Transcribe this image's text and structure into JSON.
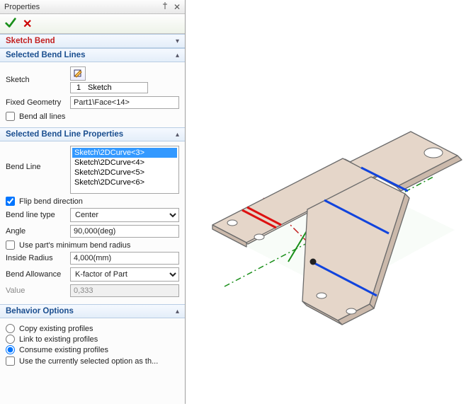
{
  "panel": {
    "title": "Properties",
    "feature_name": "Sketch Bend"
  },
  "sections": {
    "selected_bend_lines": {
      "title": "Selected Bend Lines",
      "sketch_label": "Sketch",
      "sketch_index": "1",
      "sketch_name": "Sketch",
      "fixed_geometry_label": "Fixed Geometry",
      "fixed_geometry_value": "Part1\\Face<14>",
      "bend_all_label": "Bend all lines"
    },
    "bend_props": {
      "title": "Selected Bend Line Properties",
      "bend_line_label": "Bend Line",
      "items": [
        "Sketch\\2DCurve<3>",
        "Sketch\\2DCurve<4>",
        "Sketch\\2DCurve<5>",
        "Sketch\\2DCurve<6>"
      ],
      "flip_label": "Flip bend direction",
      "line_type_label": "Bend line type",
      "line_type_value": "Center",
      "angle_label": "Angle",
      "angle_value": "90,000(deg)",
      "use_min_radius_label": "Use part's minimum bend radius",
      "inside_radius_label": "Inside Radius",
      "inside_radius_value": "4,000(mm)",
      "bend_allowance_label": "Bend Allowance",
      "bend_allowance_value": "K-factor of Part",
      "value_label": "Value",
      "value_value": "0,333"
    },
    "behavior": {
      "title": "Behavior Options",
      "copy_label": "Copy existing profiles",
      "link_label": "Link to existing profiles",
      "consume_label": "Consume existing profiles",
      "default_label": "Use the currently selected option as th..."
    }
  }
}
